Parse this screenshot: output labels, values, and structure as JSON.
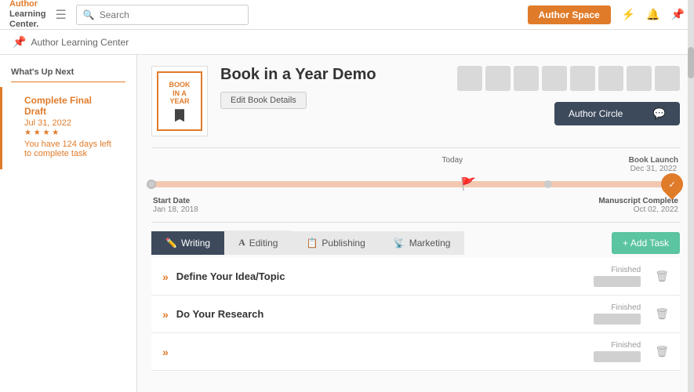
{
  "header": {
    "logo_line1": "Author",
    "logo_line2": "Learning",
    "logo_line3": "Center.",
    "search_placeholder": "Search",
    "author_space_label": "Author Space",
    "icons": [
      "lightning",
      "bell",
      "location"
    ]
  },
  "breadcrumb": {
    "text": "Author Learning Center"
  },
  "sidebar": {
    "whats_up_next": "What's Up Next",
    "task_name": "Complete Final Draft",
    "task_date": "Jul 31, 2022",
    "task_stars": "★ ★ ★ ★",
    "task_desc": "You have 124 days left to complete task"
  },
  "book": {
    "cover_line1": "BOOK",
    "cover_line2": "IN A",
    "cover_line3": "YEAR",
    "title": "Book in a Year Demo",
    "edit_button": "Edit Book Details",
    "author_circle_label": "Author Circle"
  },
  "timeline": {
    "today_label": "Today",
    "book_launch_label": "Book Launch",
    "book_launch_date": "Dec 31, 2022",
    "start_label": "Start Date",
    "start_date": "Jan 18, 2018",
    "end_label": "Manuscript Complete",
    "end_date": "Oct 02, 2022"
  },
  "tabs": {
    "items": [
      {
        "label": "Writing",
        "icon": "✏️",
        "active": true
      },
      {
        "label": "Editing",
        "icon": "A",
        "active": false
      },
      {
        "label": "Publishing",
        "icon": "📋",
        "active": false
      },
      {
        "label": "Marketing",
        "icon": "📡",
        "active": false
      }
    ],
    "add_task_label": "+ Add Task"
  },
  "tasks": [
    {
      "name": "Define Your Idea/Topic",
      "finished_label": "Finished"
    },
    {
      "name": "Do Your Research",
      "finished_label": "Finished"
    },
    {
      "name": "",
      "finished_label": "Finished"
    }
  ]
}
